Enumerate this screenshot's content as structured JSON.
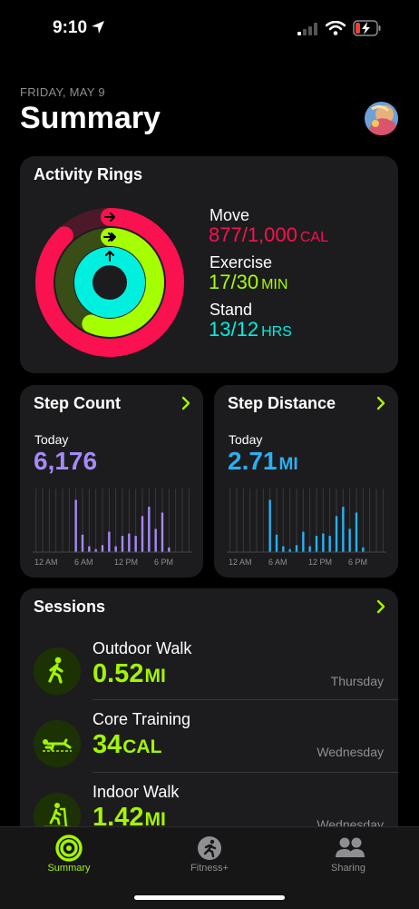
{
  "status": {
    "time": "9:10"
  },
  "header": {
    "date": "FRIDAY, MAY 9",
    "title": "Summary"
  },
  "rings": {
    "title": "Activity Rings",
    "move": {
      "label": "Move",
      "value": "877/1,000",
      "unit": "CAL",
      "color": "#fa114f",
      "progress": 0.877
    },
    "exercise": {
      "label": "Exercise",
      "value": "17/30",
      "unit": "MIN",
      "color": "#a6ff00",
      "progress": 0.567
    },
    "stand": {
      "label": "Stand",
      "value": "13/12",
      "unit": "HRS",
      "color": "#00f0e0",
      "progress": 1.083
    }
  },
  "step_count": {
    "title": "Step Count",
    "today_label": "Today",
    "value": "6,176",
    "color": "#a68af7",
    "axis": [
      "12 AM",
      "6 AM",
      "12 PM",
      "6 PM"
    ]
  },
  "step_distance": {
    "title": "Step Distance",
    "today_label": "Today",
    "value": "2.71",
    "unit": "MI",
    "color": "#2ab0f2",
    "axis": [
      "12 AM",
      "6 AM",
      "12 PM",
      "6 PM"
    ]
  },
  "hourly_bars": [
    0,
    0,
    0,
    0,
    0,
    0,
    0.9,
    0.3,
    0.1,
    0.05,
    0.12,
    0.35,
    0.1,
    0.28,
    0.32,
    0.28,
    0.62,
    0.78,
    0.4,
    0.68,
    0.08,
    0,
    0,
    0
  ],
  "sessions": {
    "title": "Sessions",
    "items": [
      {
        "name": "Outdoor Walk",
        "value": "0.52",
        "unit": "MI",
        "day": "Thursday",
        "icon": "walk-icon"
      },
      {
        "name": "Core Training",
        "value": "34",
        "unit": "CAL",
        "day": "Wednesday",
        "icon": "core-training-icon"
      },
      {
        "name": "Indoor Walk",
        "value": "1.42",
        "unit": "MI",
        "day": "Wednesday",
        "icon": "treadmill-icon"
      }
    ]
  },
  "tabs": [
    {
      "label": "Summary",
      "active": true,
      "icon": "rings-icon"
    },
    {
      "label": "Fitness+",
      "active": false,
      "icon": "fitness-plus-icon"
    },
    {
      "label": "Sharing",
      "active": false,
      "icon": "sharing-icon"
    }
  ],
  "colors": {
    "accent": "#a3f500",
    "card": "#1c1c1e",
    "secondary_text": "#8e8e93"
  }
}
